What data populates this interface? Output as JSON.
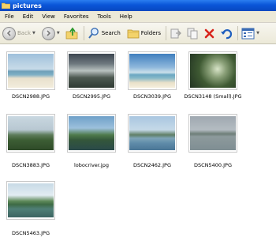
{
  "window": {
    "title": "pictures"
  },
  "menu": [
    "File",
    "Edit",
    "View",
    "Favorites",
    "Tools",
    "Help"
  ],
  "toolbar": {
    "back_label": "Back",
    "search_label": "Search",
    "folders_label": "Folders"
  },
  "files": [
    {
      "name": "DSCN2988.JPG"
    },
    {
      "name": "DSCN2995.JPG"
    },
    {
      "name": "DSCN3039.JPG"
    },
    {
      "name": "DSCN3148 (Small).JPG"
    },
    {
      "name": "DSCN3883.JPG"
    },
    {
      "name": "lobocriver.jpg"
    },
    {
      "name": "DSCN2462.JPG"
    },
    {
      "name": "DSCN5400.JPG"
    },
    {
      "name": "DSCN5463.JPG"
    }
  ]
}
